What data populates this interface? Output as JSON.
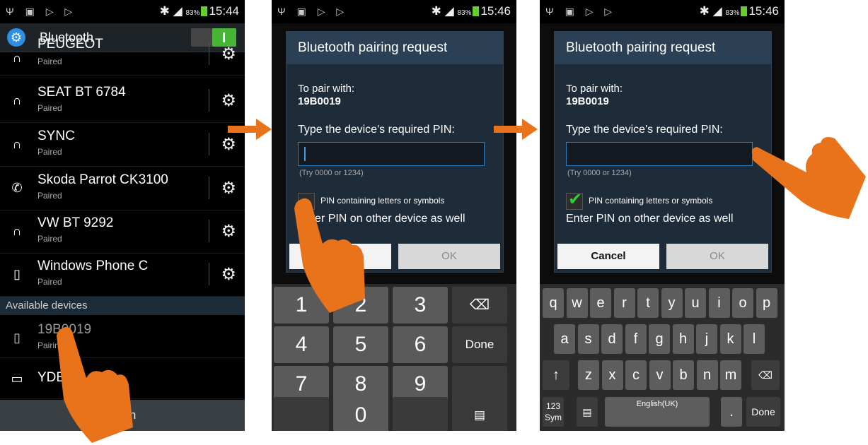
{
  "status_bar": {
    "left_icons": "Ψ ▣ ▷ ▷",
    "battery_pct": "83%",
    "times": [
      "15:44",
      "15:46",
      "15:46"
    ]
  },
  "panel1": {
    "header_title": "Bluetooth",
    "devices": [
      {
        "name": "PEUGEOT",
        "status": "Paired",
        "icon": "headset-icon"
      },
      {
        "name": "SEAT BT 6784",
        "status": "Paired",
        "icon": "headset-icon"
      },
      {
        "name": "SYNC",
        "status": "Paired",
        "icon": "headset-icon"
      },
      {
        "name": "Skoda Parrot CK3100",
        "status": "Paired",
        "icon": "phone-handset-icon"
      },
      {
        "name": "VW BT 9292",
        "status": "Paired",
        "icon": "headset-icon"
      },
      {
        "name": "Windows Phone C",
        "status": "Paired",
        "icon": "mobile-icon"
      }
    ],
    "section_label": "Available devices",
    "available": [
      {
        "name": "19B0019",
        "status": "Pairing...",
        "icon": "mobile-icon"
      },
      {
        "name": "YDE",
        "status": "",
        "icon": "laptop-icon"
      }
    ],
    "scan_label": "Scan"
  },
  "dialog": {
    "title": "Bluetooth pairing request",
    "to_pair_label": "To pair with:",
    "device_id": "19B0019",
    "pin_prompt": "Type the device's required PIN:",
    "hint": "(Try 0000 or 1234)",
    "checkbox_label": "PIN containing letters or symbols",
    "enter_label": "Enter PIN on other device as well",
    "cancel_label": "Cancel",
    "ok_label": "OK"
  },
  "numpad": {
    "keys": [
      "1",
      "2",
      "3",
      "⌫",
      "4",
      "5",
      "6",
      "Done",
      "7",
      "8",
      "9",
      "",
      "",
      "0",
      "",
      ""
    ]
  },
  "qwerty": {
    "row1": [
      "q",
      "w",
      "e",
      "r",
      "t",
      "y",
      "u",
      "i",
      "o",
      "p"
    ],
    "row2": [
      "a",
      "s",
      "d",
      "f",
      "g",
      "h",
      "j",
      "k",
      "l"
    ],
    "row3": [
      "z",
      "x",
      "c",
      "v",
      "b",
      "n",
      "m"
    ],
    "sym_label": "123 Sym",
    "space_label": "English(UK)",
    "done_label": "Done"
  },
  "colors": {
    "accent_arrow": "#e8731a",
    "bt_toggle_on": "#46b634",
    "dialog_title_bg": "#2c4055"
  }
}
